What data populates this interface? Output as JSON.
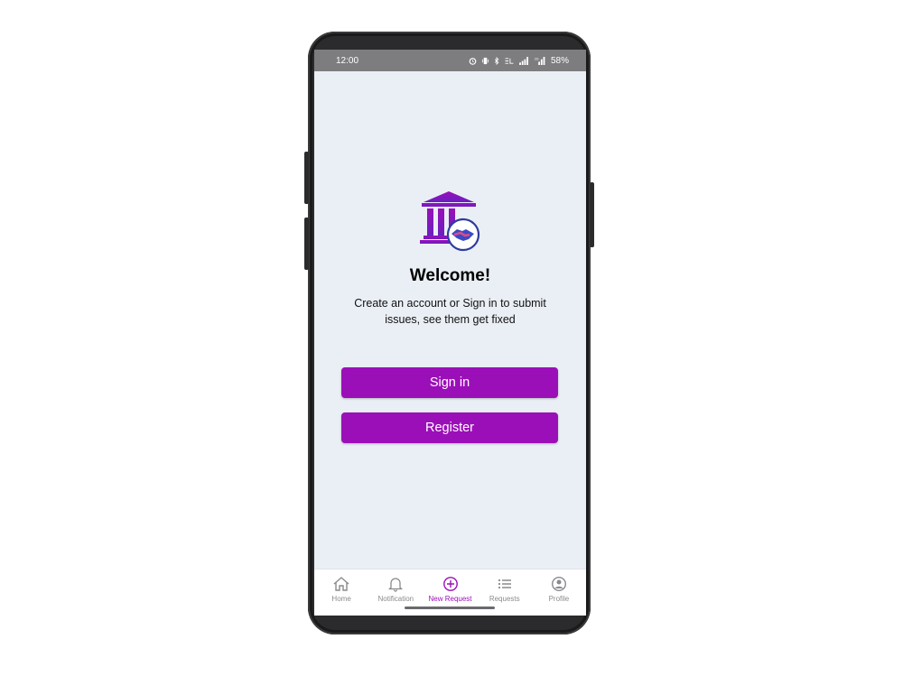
{
  "status_bar": {
    "time": "12:00",
    "battery": "58%"
  },
  "welcome": {
    "title": "Welcome!",
    "subtitle": "Create an account or Sign in to submit issues, see them get fixed"
  },
  "buttons": {
    "sign_in": "Sign in",
    "register": "Register"
  },
  "bottom_nav": {
    "items": [
      {
        "label": "Home",
        "icon": "home-icon"
      },
      {
        "label": "Notification",
        "icon": "bell-icon"
      },
      {
        "label": "New Request",
        "icon": "plus-circle-icon",
        "active": true
      },
      {
        "label": "Requests",
        "icon": "list-icon"
      },
      {
        "label": "Profile",
        "icon": "profile-icon"
      }
    ]
  },
  "colors": {
    "accent": "#9b0fb8",
    "background": "#eaeff6",
    "status_bar": "#7d7d7f"
  }
}
